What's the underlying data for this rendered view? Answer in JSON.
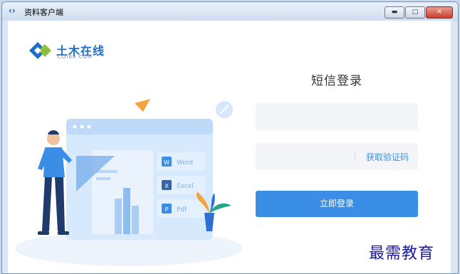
{
  "window": {
    "title": "资料客户端",
    "min_symbol": "▬",
    "max_symbol": "□",
    "close_symbol": "✕"
  },
  "logo": {
    "name": "土木在线",
    "sub": "COI88.COM"
  },
  "illustration": {
    "word_label": "Word",
    "excel_label": "Excel",
    "pdf_label": "Pdf",
    "word_letter": "W",
    "excel_letter": "X",
    "pdf_letter": "P"
  },
  "login": {
    "heading": "短信登录",
    "get_code_label": "获取验证码",
    "submit_label": "立即登录"
  },
  "watermark": "最需教育",
  "colors": {
    "accent": "#3a8ee6",
    "titlebar": "#dbe7f5"
  }
}
